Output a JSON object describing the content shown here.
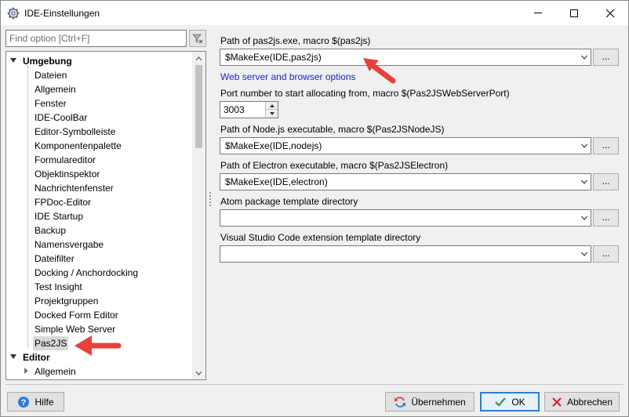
{
  "window": {
    "title": "IDE-Einstellungen",
    "controls": {
      "minimize": "minimize",
      "maximize": "maximize",
      "close": "close"
    }
  },
  "filter": {
    "placeholder": "Find option [Ctrl+F]"
  },
  "tree": {
    "items": [
      {
        "label": "Umgebung",
        "kind": "category",
        "expanded": true
      },
      {
        "label": "Dateien",
        "kind": "item"
      },
      {
        "label": "Allgemein",
        "kind": "item"
      },
      {
        "label": "Fenster",
        "kind": "item"
      },
      {
        "label": "IDE-CoolBar",
        "kind": "item"
      },
      {
        "label": "Editor-Symbolleiste",
        "kind": "item"
      },
      {
        "label": "Komponentenpalette",
        "kind": "item"
      },
      {
        "label": "Formulareditor",
        "kind": "item"
      },
      {
        "label": "Objektinspektor",
        "kind": "item"
      },
      {
        "label": "Nachrichtenfenster",
        "kind": "item"
      },
      {
        "label": "FPDoc-Editor",
        "kind": "item"
      },
      {
        "label": "IDE Startup",
        "kind": "item"
      },
      {
        "label": "Backup",
        "kind": "item"
      },
      {
        "label": "Namensvergabe",
        "kind": "item"
      },
      {
        "label": "Dateifilter",
        "kind": "item"
      },
      {
        "label": "Docking / Anchordocking",
        "kind": "item"
      },
      {
        "label": "Test Insight",
        "kind": "item"
      },
      {
        "label": "Projektgruppen",
        "kind": "item"
      },
      {
        "label": "Docked Form Editor",
        "kind": "item"
      },
      {
        "label": "Simple Web Server",
        "kind": "item"
      },
      {
        "label": "Pas2JS",
        "kind": "item",
        "selected": true
      },
      {
        "label": "Editor",
        "kind": "category",
        "expanded": true
      },
      {
        "label": "Allgemein",
        "kind": "subcollapsed"
      }
    ]
  },
  "settings": {
    "pas2js_path": {
      "label": "Path of pas2js.exe, macro $(pas2js)",
      "value": "$MakeExe(IDE,pas2js)",
      "browse": "..."
    },
    "web_server_link": "Web server and browser options",
    "port": {
      "label": "Port number to start allocating from, macro $(Pas2JSWebServerPort)",
      "value": "3003"
    },
    "nodejs_path": {
      "label": "Path of Node.js executable, macro $(Pas2JSNodeJS)",
      "value": "$MakeExe(IDE,nodejs)",
      "browse": "..."
    },
    "electron_path": {
      "label": "Path of Electron executable, macro $(Pas2JSElectron)",
      "value": "$MakeExe(IDE,electron)",
      "browse": "..."
    },
    "atom_dir": {
      "label": "Atom package template directory",
      "value": "",
      "browse": "..."
    },
    "vscode_dir": {
      "label": "Visual Studio Code extension template directory",
      "value": "",
      "browse": "..."
    }
  },
  "buttons": {
    "help": "Hilfe",
    "apply": "Übernehmen",
    "ok": "OK",
    "cancel": "Abbrechen"
  },
  "colors": {
    "link": "#1d24d6",
    "annotation_arrow": "#e8403a",
    "ok_border": "#2f7cd3"
  }
}
